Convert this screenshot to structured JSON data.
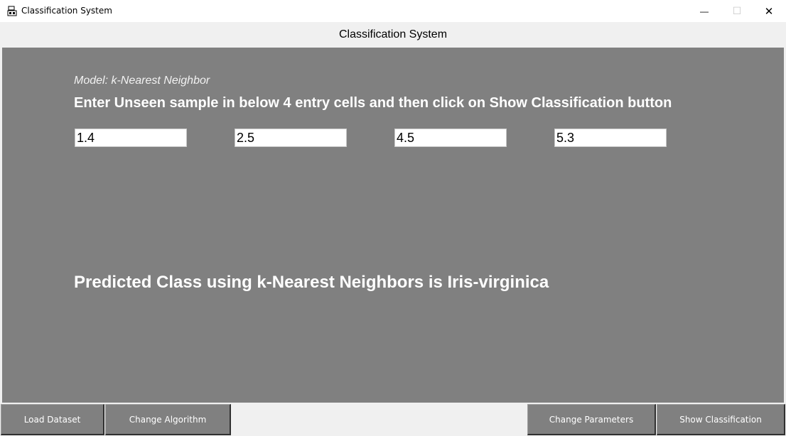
{
  "window": {
    "title": "Classification System",
    "icon": "app-icon",
    "controls": {
      "minimize": "—",
      "maximize": "☐",
      "close": "✕"
    }
  },
  "header": {
    "title": "Classification System"
  },
  "main": {
    "model_label": "Model: k-Nearest Neighbor",
    "instruction": "Enter Unseen sample in below 4 entry cells and then click on Show Classification button",
    "entries": [
      "1.4",
      "2.5",
      "4.5",
      "5.3"
    ],
    "result": "Predicted Class using k-Nearest Neighbors is Iris-virginica"
  },
  "buttons": {
    "load_dataset": "Load Dataset",
    "change_algorithm": "Change Algorithm",
    "change_parameters": "Change Parameters",
    "show_classification": "Show Classification"
  },
  "colors": {
    "panel_bg": "#808080",
    "text_light": "#ffffff"
  }
}
